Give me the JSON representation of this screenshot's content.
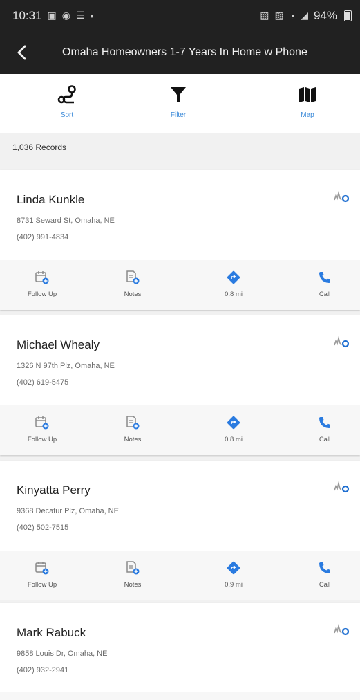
{
  "status_bar": {
    "time": "10:31",
    "battery": "94%"
  },
  "header": {
    "title": "Omaha Homeowners 1-7 Years In Home w Phone"
  },
  "toolbar": {
    "sort_label": "Sort",
    "filter_label": "Filter",
    "map_label": "Map"
  },
  "records_count": "1,036 Records",
  "actions": {
    "follow_up": "Follow Up",
    "notes": "Notes",
    "call": "Call"
  },
  "contacts": [
    {
      "name": "Linda Kunkle",
      "address": "8731 Seward St, Omaha, NE",
      "phone": "(402) 991-4834",
      "distance": "0.8 mi"
    },
    {
      "name": "Michael Whealy",
      "address": "1326 N 97th Plz, Omaha, NE",
      "phone": "(402) 619-5475",
      "distance": "0.8 mi"
    },
    {
      "name": "Kinyatta Perry",
      "address": "9368 Decatur Plz, Omaha, NE",
      "phone": "(402) 502-7515",
      "distance": "0.9 mi"
    },
    {
      "name": "Mark Rabuck",
      "address": "9858 Louis Dr, Omaha, NE",
      "phone": "(402) 932-2941"
    }
  ],
  "colors": {
    "accent": "#3d8bd9",
    "topbar": "#212121"
  }
}
